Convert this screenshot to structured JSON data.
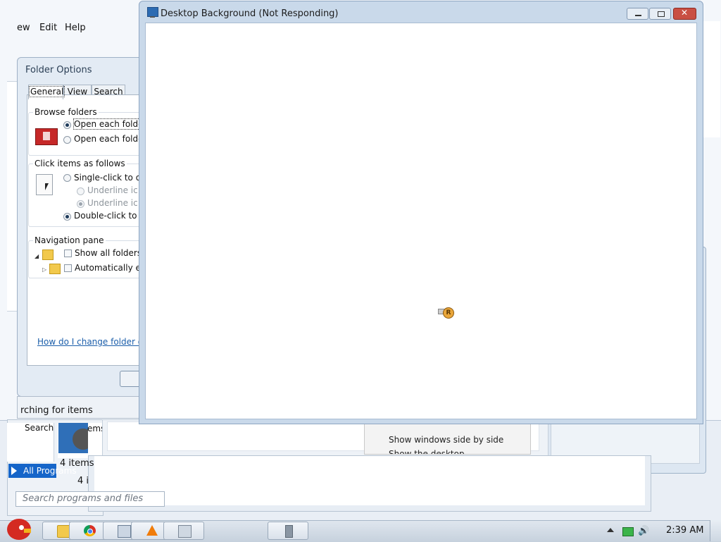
{
  "explorer": {
    "menu": [
      "ew",
      "Edit",
      "Help"
    ]
  },
  "folder_options": {
    "title": "Folder Options",
    "tabs": [
      "General",
      "View",
      "Search"
    ],
    "browse_folders": {
      "title": "Browse folders",
      "options": [
        "Open each folde",
        "Open each folde"
      ],
      "selected_index": 0
    },
    "click_items": {
      "title": "Click items as follows",
      "options": [
        "Single-click to op",
        "Underline ic",
        "Underline ic",
        "Double-click to o"
      ],
      "selected": "Double-click to o"
    },
    "navigation_pane": {
      "title": "Navigation pane",
      "options": [
        "Show all folders",
        "Automatically ex"
      ]
    },
    "help_link": "How do I change folder options"
  },
  "search_strip": "rching for items",
  "context_menu": {
    "items": [
      "Show windows side by side",
      "Show the desktop"
    ]
  },
  "start_menu": {
    "search_label": "Search",
    "items_label_a": "4 items",
    "items_label_b": "4 i",
    "items_label_c": "ems",
    "all_programs": "All Programs",
    "search_placeholder": "Search programs and files"
  },
  "desktop_background_window": {
    "title": "Desktop Background (Not Responding)",
    "busy_cursor_glyph": "R"
  },
  "taskbar": {
    "clock": "2:39 AM",
    "pinned": [
      "folder-icon",
      "chrome-icon",
      "window-icon",
      "vlc-icon",
      "calculator-icon",
      "speaker-app-icon"
    ]
  }
}
